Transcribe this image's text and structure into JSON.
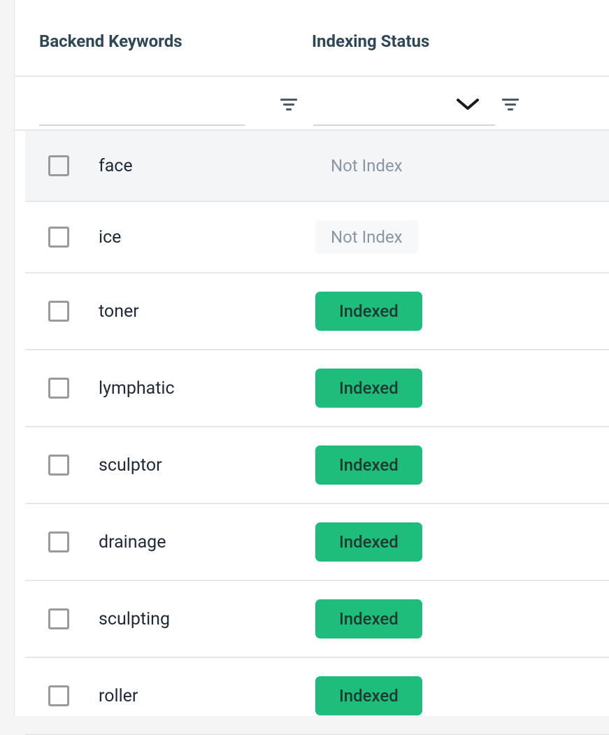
{
  "headers": {
    "keywords": "Backend Keywords",
    "status": "Indexing Status"
  },
  "status_labels": {
    "not_index": "Not Index",
    "indexed": "Indexed"
  },
  "rows": [
    {
      "keyword": "face",
      "status": "not_index",
      "highlighted": true,
      "status_bg": false
    },
    {
      "keyword": "ice",
      "status": "not_index",
      "highlighted": false,
      "status_bg": true
    },
    {
      "keyword": "toner",
      "status": "indexed",
      "highlighted": false,
      "status_bg": false
    },
    {
      "keyword": "lymphatic",
      "status": "indexed",
      "highlighted": false,
      "status_bg": false
    },
    {
      "keyword": "sculptor",
      "status": "indexed",
      "highlighted": false,
      "status_bg": false
    },
    {
      "keyword": "drainage",
      "status": "indexed",
      "highlighted": false,
      "status_bg": false
    },
    {
      "keyword": "sculpting",
      "status": "indexed",
      "highlighted": false,
      "status_bg": false
    },
    {
      "keyword": "roller",
      "status": "indexed",
      "highlighted": false,
      "status_bg": false
    }
  ]
}
